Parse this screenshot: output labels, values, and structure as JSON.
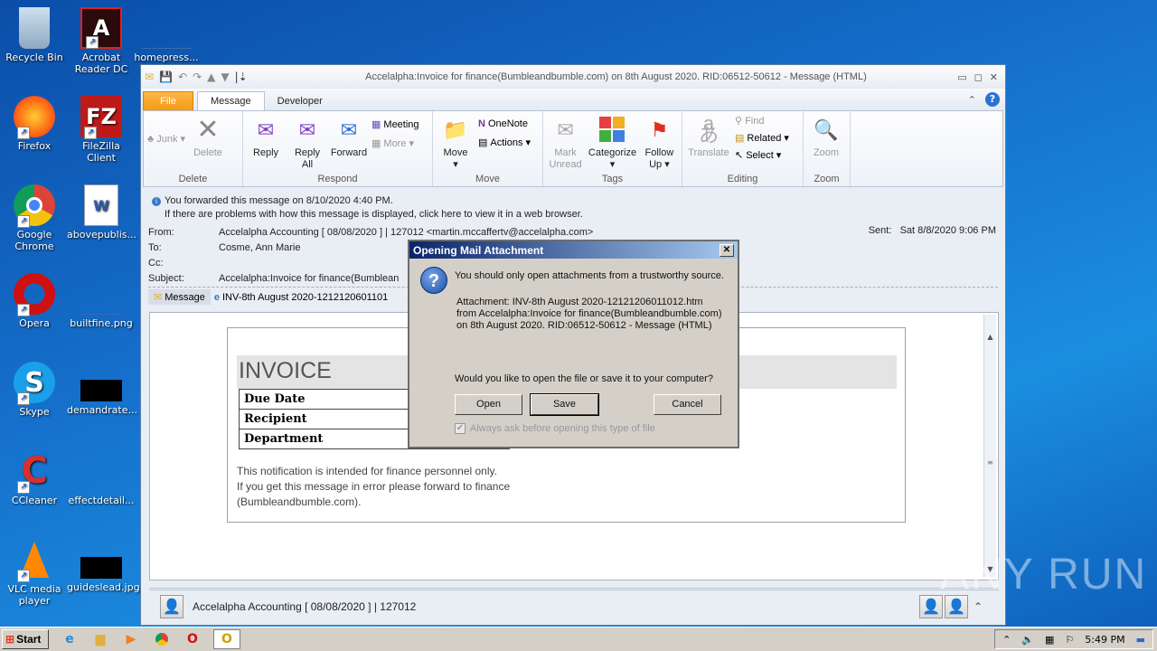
{
  "desktop": {
    "icons": [
      {
        "label": "Recycle Bin",
        "icon": "recycle-bin-icon"
      },
      {
        "label": "Acrobat Reader DC",
        "icon": "acrobat-icon"
      },
      {
        "label": "homepress...",
        "icon": "file-icon"
      },
      {
        "label": "Firefox",
        "icon": "firefox-icon"
      },
      {
        "label": "FileZilla Client",
        "icon": "filezilla-icon"
      },
      {
        "label": "Google Chrome",
        "icon": "chrome-icon"
      },
      {
        "label": "abovepublis...",
        "icon": "word-doc-icon"
      },
      {
        "label": "Opera",
        "icon": "opera-icon"
      },
      {
        "label": "builtfine.png",
        "icon": "image-file-icon"
      },
      {
        "label": "Skype",
        "icon": "skype-icon"
      },
      {
        "label": "demandrate...",
        "icon": "image-file-icon"
      },
      {
        "label": "CCleaner",
        "icon": "ccleaner-icon"
      },
      {
        "label": "effectdetail...",
        "icon": "image-file-icon"
      },
      {
        "label": "VLC media player",
        "icon": "vlc-icon"
      },
      {
        "label": "guideslead.jpg",
        "icon": "image-file-icon"
      }
    ]
  },
  "window": {
    "title": "Accelalpha:Invoice for finance(Bumbleandbumble.com) on 8th August 2020. RID:06512-50612  -  Message (HTML)",
    "tabs": [
      "File",
      "Message",
      "Developer"
    ],
    "active_tab": "Message"
  },
  "ribbon": {
    "delete": {
      "label": "Delete",
      "junk": "Junk",
      "delete": "Delete"
    },
    "respond": {
      "label": "Respond",
      "reply": "Reply",
      "reply_all_1": "Reply",
      "reply_all_2": "All",
      "forward": "Forward",
      "meeting": "Meeting",
      "more": "More"
    },
    "move": {
      "label": "Move",
      "move": "Move",
      "onenote": "OneNote",
      "actions": "Actions"
    },
    "tags": {
      "label": "Tags",
      "mark_1": "Mark",
      "mark_2": "Unread",
      "categorize": "Categorize",
      "follow_1": "Follow",
      "follow_2": "Up"
    },
    "editing": {
      "label": "Editing",
      "translate": "Translate",
      "find": "Find",
      "related": "Related",
      "select": "Select"
    },
    "zoom": {
      "label": "Zoom",
      "zoom": "Zoom"
    }
  },
  "message": {
    "info_1": "You forwarded this message on 8/10/2020 4:40 PM.",
    "info_2": "If there are problems with how this message is displayed, click here to view it in a web browser.",
    "from_label": "From:",
    "from": "Accelalpha Accounting [ 08/08/2020 ] | 127012 <martin.mccaffertv@accelalpha.com>",
    "to_label": "To:",
    "to": "Cosme, Ann Marie",
    "cc_label": "Cc:",
    "cc": "",
    "subject_label": "Subject:",
    "subject": "Accelalpha:Invoice for finance(Bumblean",
    "sent_label": "Sent:",
    "sent": "Sat 8/8/2020 9:06 PM",
    "message_tab": "Message",
    "attachment": "INV-8th August 2020-1212120601101"
  },
  "body": {
    "heading": "INVOICE",
    "rows": [
      "Due Date",
      "Recipient",
      "Department"
    ],
    "notice_1": "This notification is intended for finance personnel only.",
    "notice_2": "If you get this message in error please forward to finance",
    "notice_3": "(Bumbleandbumble.com)."
  },
  "footer": {
    "sender": "Accelalpha Accounting [ 08/08/2020 ] | 127012"
  },
  "dialog": {
    "title": "Opening Mail Attachment",
    "warning": "You should only open attachments from a trustworthy source.",
    "attach_line": "Attachment: INV-8th August 2020-12121206011012.htm",
    "from_line": "from Accelalpha:Invoice for finance(Bumbleandbumble.com)",
    "on_line": "on 8th August 2020. RID:06512-50612 - Message (HTML)",
    "question": "Would you like to open the file or save it to your computer?",
    "open": "Open",
    "save": "Save",
    "cancel": "Cancel",
    "checkbox": "Always ask before opening this type of file",
    "checkbox_checked": true
  },
  "taskbar": {
    "start": "Start",
    "clock": "5:49 PM"
  },
  "watermark": "ANY RUN"
}
